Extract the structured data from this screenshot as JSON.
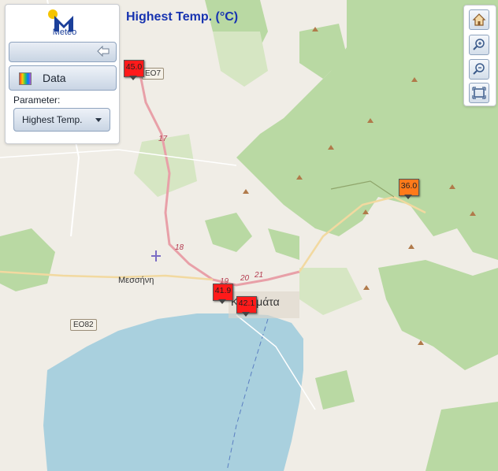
{
  "app": {
    "logo_text": "Meteo",
    "title": "Highest Temp. (°C)"
  },
  "panel": {
    "data_button_label": "Data",
    "parameter_label": "Parameter:",
    "parameter_value": "Highest Temp."
  },
  "map_labels": {
    "road_17": "17",
    "road_18": "18",
    "road_19": "19",
    "road_20": "20",
    "road_21": "21",
    "town_mesini": "Μεσσήνη",
    "town_kalamata": "Καλαμάτα",
    "shield_eo82": "ΕΟ82",
    "shield_eo7": "ΕΟ7"
  },
  "stations": [
    {
      "value": "45.0",
      "color": "#ff1a1a"
    },
    {
      "value": "36.0",
      "color": "#ff7a1a"
    },
    {
      "value": "41.9",
      "color": "#ff1a1a"
    },
    {
      "value": "42.1",
      "color": "#ff1a1a"
    }
  ],
  "icons": {
    "home": "home-icon",
    "zoom_in": "zoom-in-icon",
    "zoom_out": "zoom-out-icon",
    "fullscreen": "fullscreen-icon",
    "collapse": "back-arrow-icon"
  },
  "colors": {
    "title": "#1733b0",
    "sea": "#a9d0de",
    "forest": "#b9d9a3",
    "land": "#f0ede6"
  }
}
